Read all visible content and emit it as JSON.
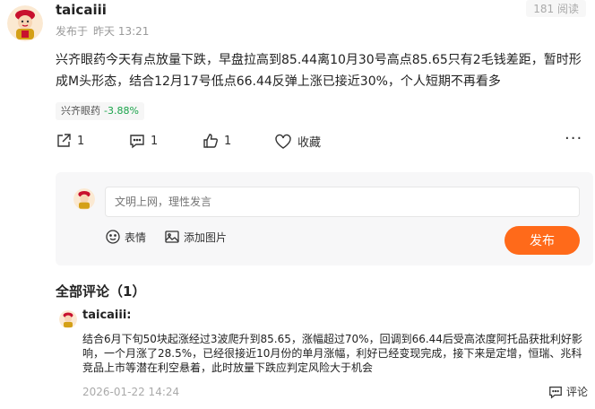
{
  "post": {
    "username": "taicaiii",
    "published_label": "发布于",
    "published_time": "昨天 13:21",
    "views": "181 阅读",
    "body": "兴齐眼药今天有点放量下跌，早盘拉高到85.44离10月30号高点85.65只有2毛钱差距，暂时形成M头形态，结合12月17号低点66.44反弹上涨已接近30%，个人短期不再看多",
    "stock_tag": {
      "name": "兴齐眼药",
      "change": "-3.88%",
      "change_color": "#1aa34a"
    },
    "actions": {
      "share_count": "1",
      "comment_count": "1",
      "like_count": "1",
      "favorite_label": "收藏",
      "more_label": "···"
    }
  },
  "comment_box": {
    "placeholder": "文明上网，理性发言",
    "emoji_label": "表情",
    "image_label": "添加图片",
    "publish_label": "发布",
    "publish_color": "#ff6a1a"
  },
  "comments": {
    "title": "全部评论（1）",
    "items": [
      {
        "username": "taicaiii:",
        "text": "结合6月下旬50块起涨经过3波爬升到85.65，涨幅超过70%，回调到66.44后受高浓度阿托品获批利好影响，一个月涨了28.5%，已经很接近10月份的单月涨幅，利好已经变现完成，接下来是定增，恒瑞、兆科竞品上市等潜在利空悬着，此时放量下跌应判定风险大于机会",
        "time": "2026-01-22 14:24",
        "reply_label": "评论"
      }
    ]
  }
}
